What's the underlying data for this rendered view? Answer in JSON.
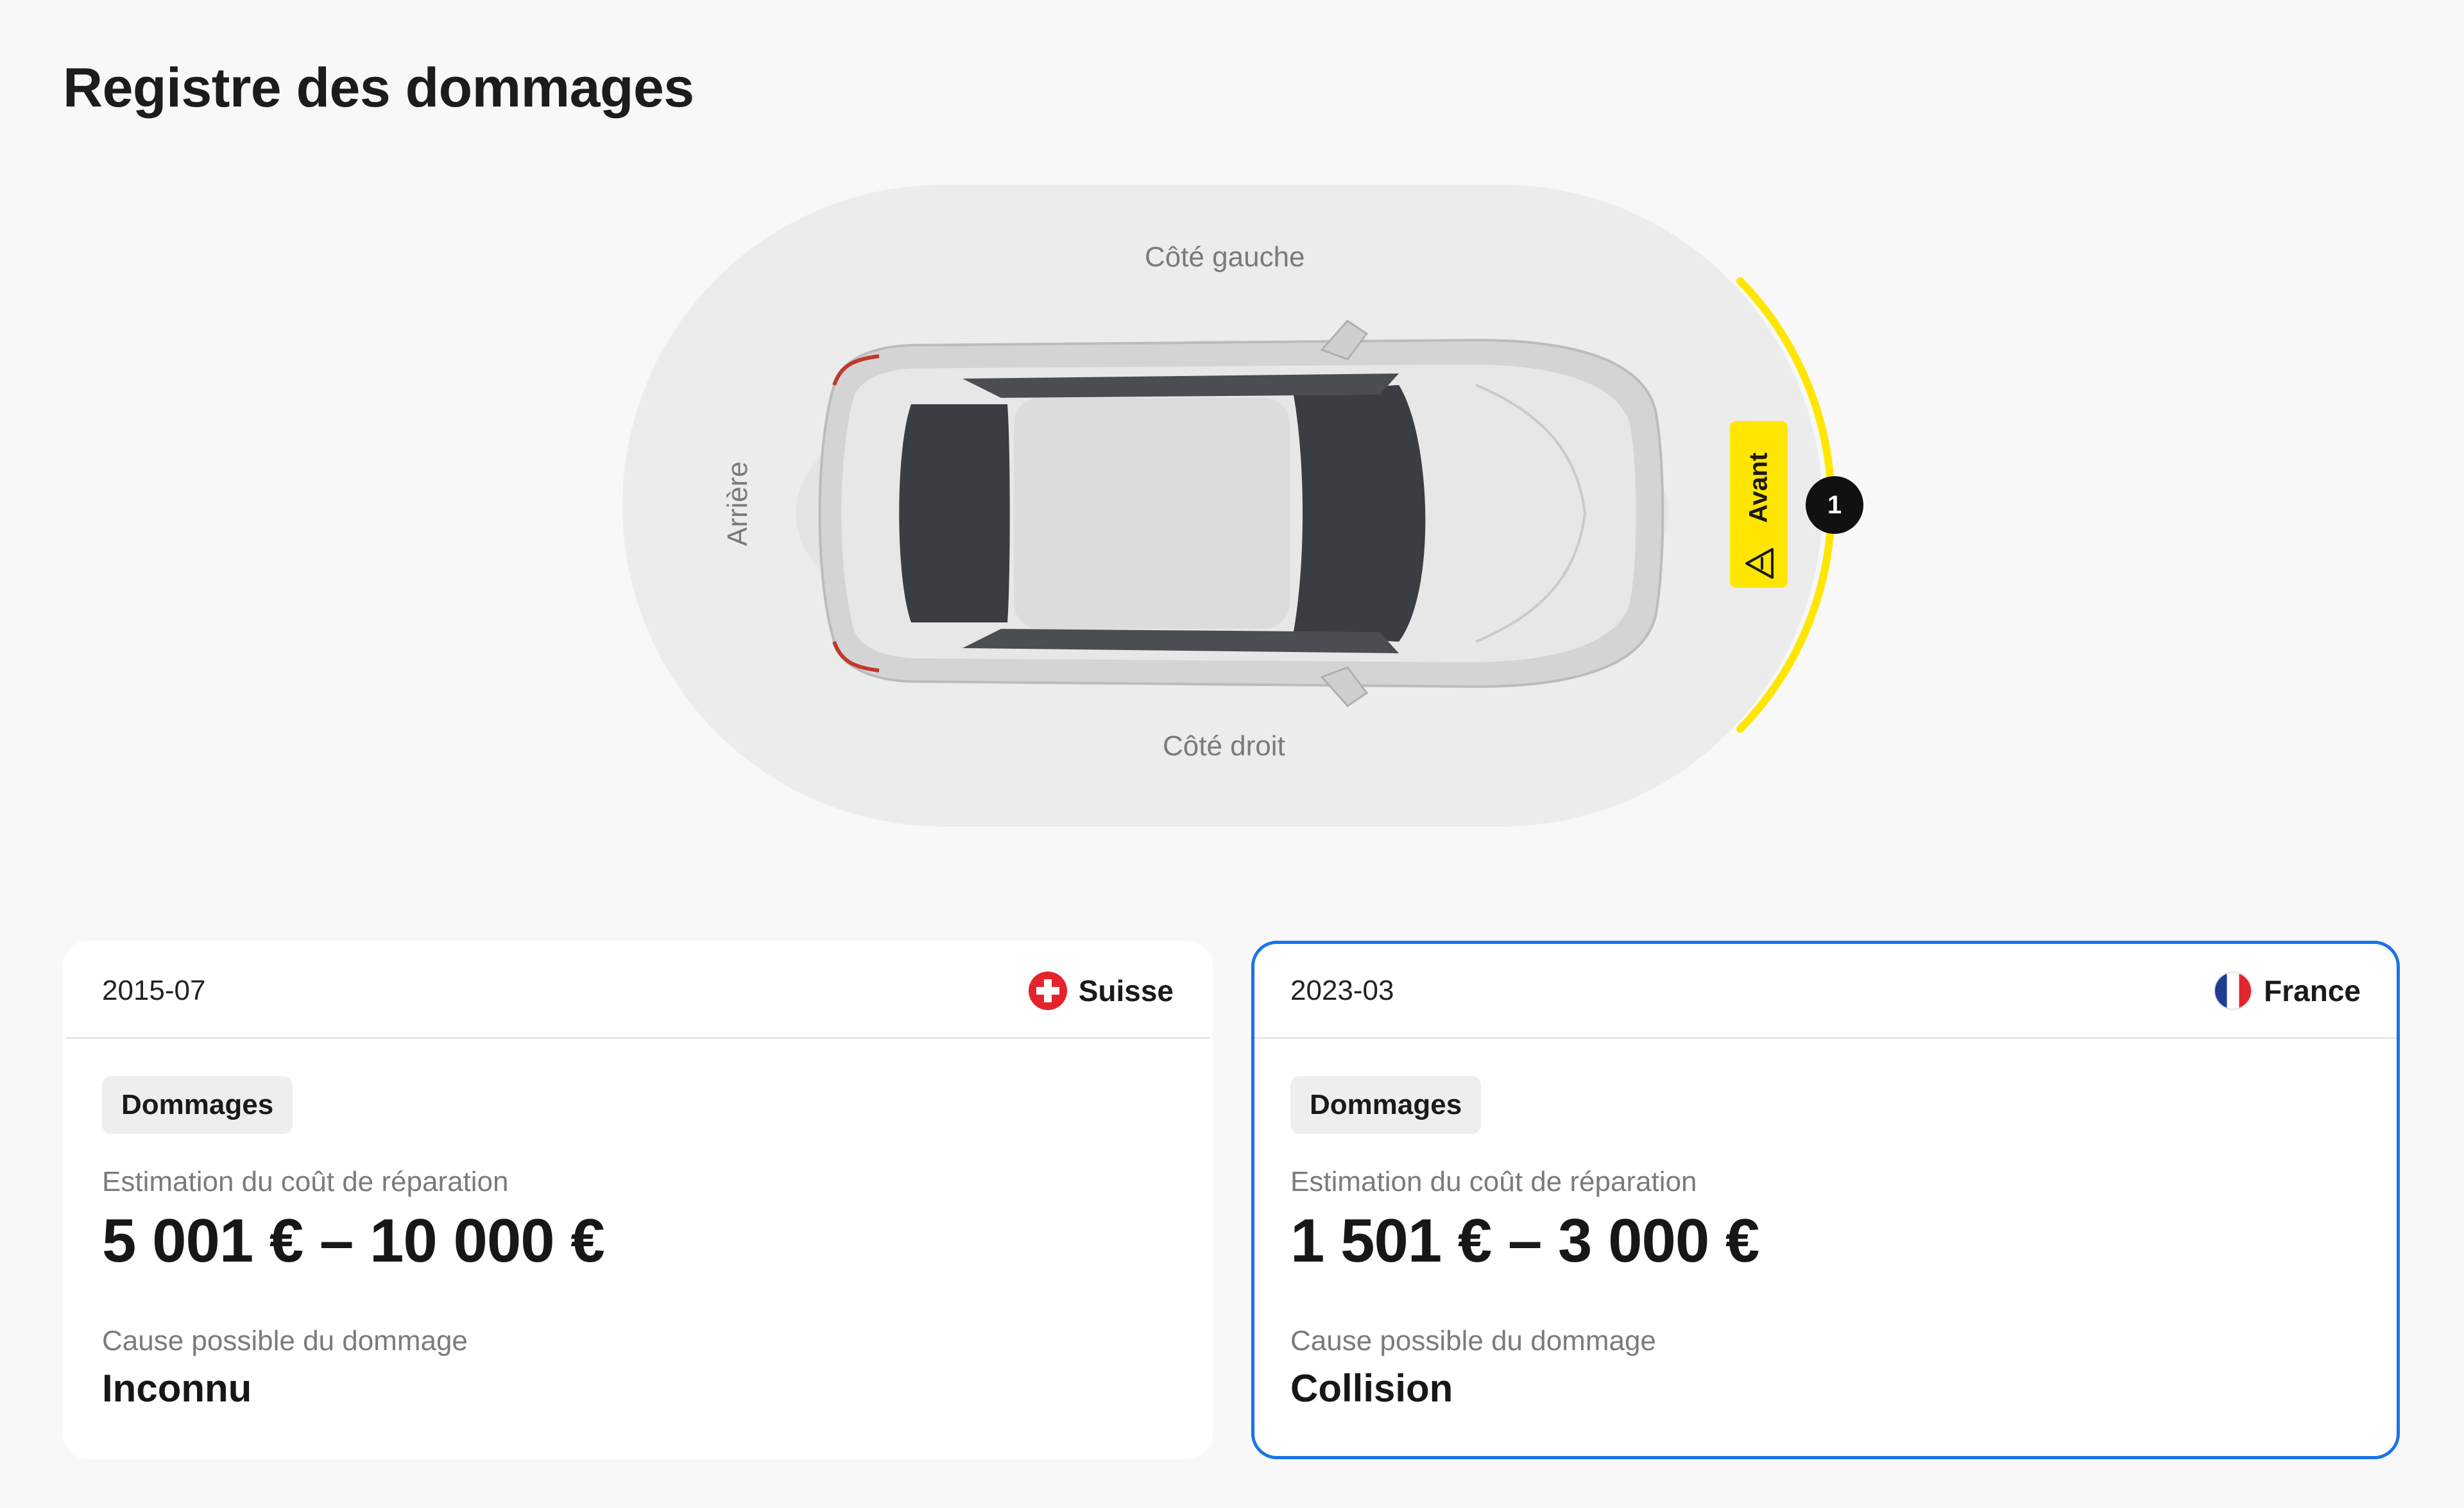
{
  "page": {
    "title": "Registre des dommages"
  },
  "diagram": {
    "side_left": "Côté gauche",
    "side_right": "Côté droit",
    "rear": "Arrière",
    "front_badge": "Avant",
    "damage_marker": "1",
    "highlight_color": "#ffe600"
  },
  "records": [
    {
      "date": "2015-07",
      "country": "Suisse",
      "flag_icon": "swiss-flag-icon",
      "tag": "Dommages",
      "cost_label": "Estimation du coût de réparation",
      "cost_value": "5 001 € – 10 000 €",
      "cause_label": "Cause possible du dommage",
      "cause_value": "Inconnu",
      "selected": false
    },
    {
      "date": "2023-03",
      "country": "France",
      "flag_icon": "french-flag-icon",
      "tag": "Dommages",
      "cost_label": "Estimation du coût de réparation",
      "cost_value": "1 501 € – 3 000 €",
      "cause_label": "Cause possible du dommage",
      "cause_value": "Collision",
      "selected": true,
      "accent": "#1a73e8"
    }
  ]
}
